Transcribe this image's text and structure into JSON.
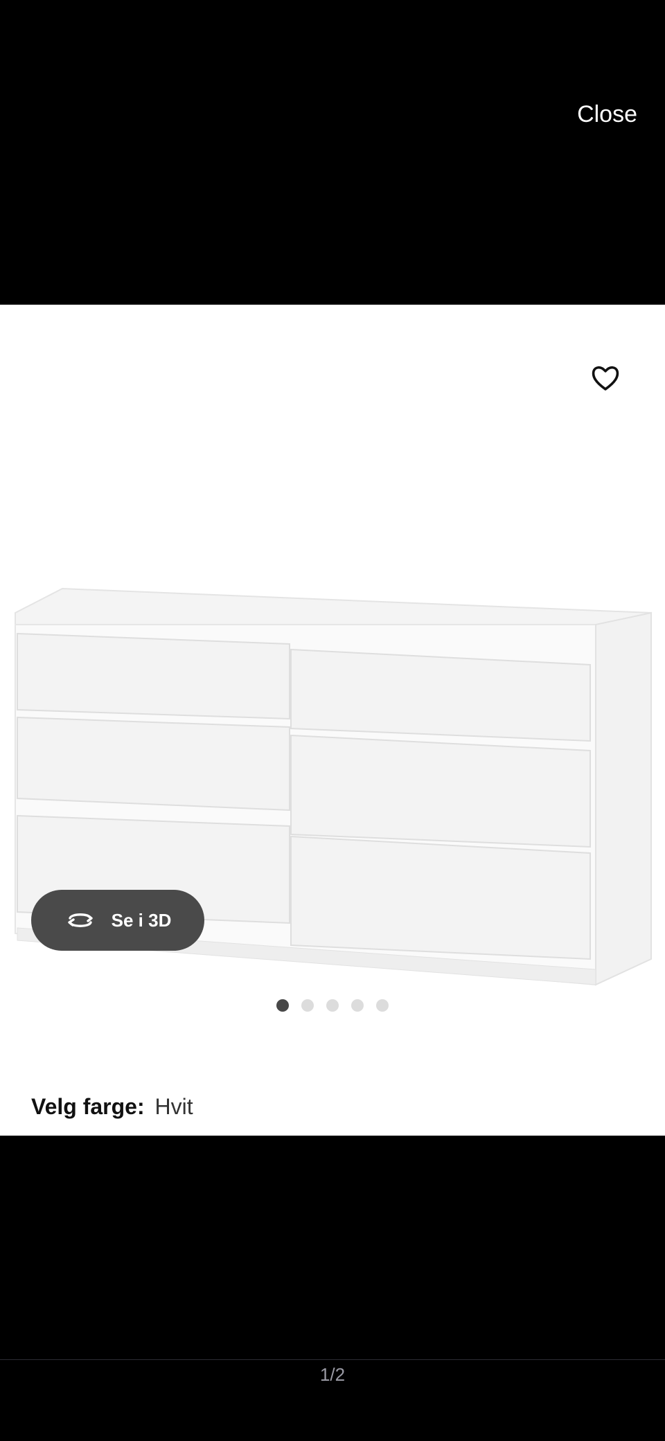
{
  "viewer": {
    "close_label": "Close",
    "page_counter": "1/2"
  },
  "product": {
    "view_3d_label": "Se i 3D",
    "color_label": "Velg farge:",
    "color_value": "Hvit",
    "carousel": {
      "total": 5,
      "active": 1
    }
  },
  "colors": {
    "viewer_background": "#000000",
    "card_background": "#ffffff",
    "button_background": "#4a4a4a",
    "dot_active": "#484848",
    "dot_inactive": "#dcdcdc"
  },
  "icons": {
    "favorite": "heart-icon",
    "view_3d": "rotate-icon"
  }
}
